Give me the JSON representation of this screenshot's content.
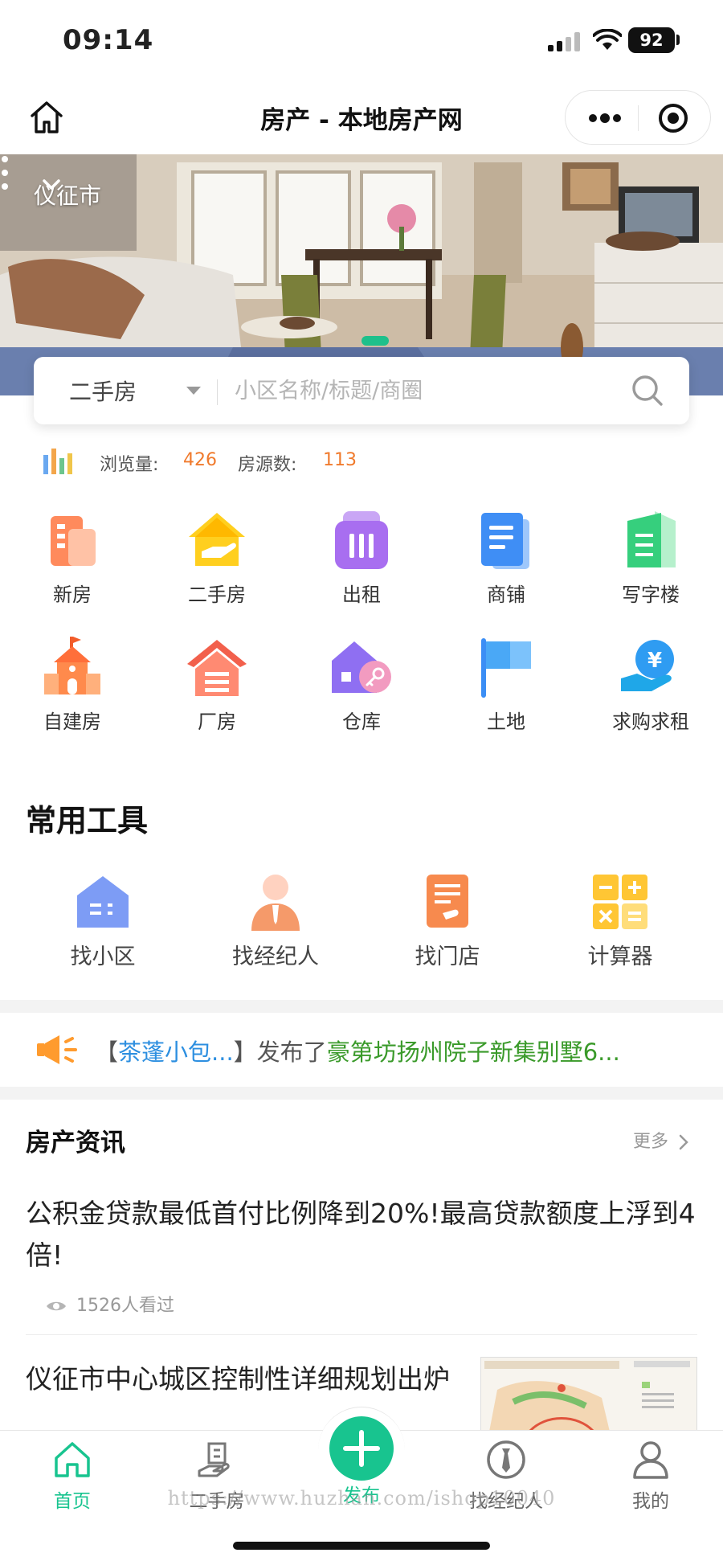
{
  "status": {
    "time": "09:14",
    "battery": "92"
  },
  "nav": {
    "title": "房产 - 本地房产网"
  },
  "banner": {
    "city": "仪征市"
  },
  "search": {
    "category": "二手房",
    "placeholder": "小区名称/标题/商圈"
  },
  "stats": {
    "views_label": "浏览量:",
    "views_value": "426",
    "listings_label": "房源数:",
    "listings_value": "113"
  },
  "categories": [
    {
      "label": "新房",
      "icon": "building-icon"
    },
    {
      "label": "二手房",
      "icon": "house-hand-icon"
    },
    {
      "label": "出租",
      "icon": "rent-icon"
    },
    {
      "label": "商铺",
      "icon": "shop-icon"
    },
    {
      "label": "写字楼",
      "icon": "office-icon"
    },
    {
      "label": "自建房",
      "icon": "self-built-house-icon"
    },
    {
      "label": "厂房",
      "icon": "factory-icon"
    },
    {
      "label": "仓库",
      "icon": "warehouse-icon"
    },
    {
      "label": "土地",
      "icon": "flag-icon"
    },
    {
      "label": "求购求租",
      "icon": "yuan-hand-icon"
    }
  ],
  "tools": {
    "title": "常用工具",
    "items": [
      {
        "label": "找小区",
        "icon": "community-icon"
      },
      {
        "label": "找经纪人",
        "icon": "agent-icon"
      },
      {
        "label": "找门店",
        "icon": "store-icon"
      },
      {
        "label": "计算器",
        "icon": "calculator-icon"
      }
    ]
  },
  "ticker": {
    "prefix": "【",
    "user": "茶蓬小包...",
    "middle": "】发布了",
    "listing": "豪第坊扬州院子新集别墅6..."
  },
  "news": {
    "title": "房产资讯",
    "more": "更多",
    "items": [
      {
        "title": "公积金贷款最低首付比例降到20%!最高贷款额度上浮到4倍!",
        "views": "1526人看过"
      },
      {
        "title": "仪征市中心城区控制性详细规划出炉"
      }
    ]
  },
  "tabbar": {
    "items": [
      {
        "label": "首页",
        "icon": "home-icon"
      },
      {
        "label": "二手房",
        "icon": "second-hand-house-icon"
      },
      {
        "label": "发布",
        "icon": "plus-icon"
      },
      {
        "label": "找经纪人",
        "icon": "agent-tie-icon"
      },
      {
        "label": "我的",
        "icon": "user-icon"
      }
    ]
  },
  "watermark": "https://www.huzhan.com/ishop10040",
  "colors": {
    "accent": "#18c48f",
    "orange": "#f07a2c",
    "link_blue": "#2d8fe0",
    "link_green": "#3a9a2a"
  }
}
